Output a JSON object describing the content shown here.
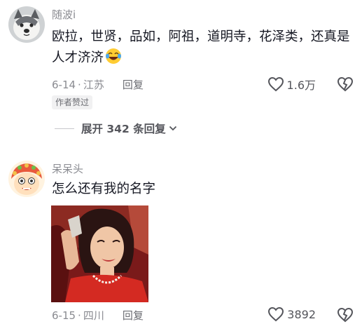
{
  "comments": [
    {
      "username": "随波i",
      "text": "欧拉，世贤，品如，阿祖，道明寺，花泽类，还真是人才济济",
      "emoji": "laughing-crying-emoji",
      "date": "6-14",
      "location": "江苏",
      "reply_label": "回复",
      "likes": "1.6万",
      "badge": "作者赞过",
      "expand_label": "展开 342 条回复"
    },
    {
      "username": "呆呆头",
      "text": "怎么还有我的名字",
      "date": "6-15",
      "location": "四川",
      "reply_label": "回复",
      "likes": "3892"
    }
  ],
  "separator": "·",
  "colors": {
    "primary_text": "#161823",
    "secondary_text": "#8a8b91",
    "badge_bg": "#f1f1f2"
  }
}
